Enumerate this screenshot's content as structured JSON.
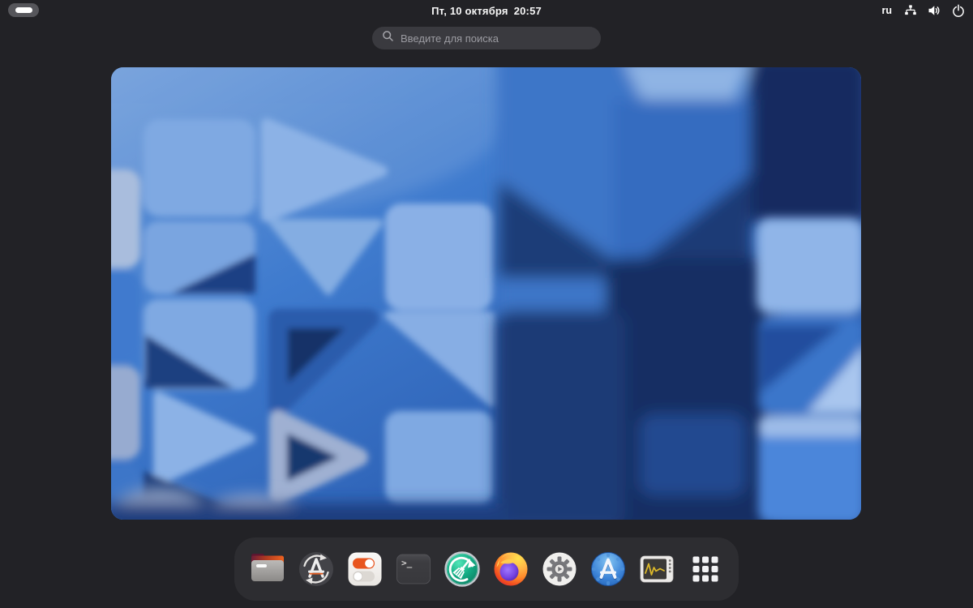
{
  "topbar": {
    "date": "Пт, 10 октября",
    "time": "20:57",
    "keyboard_layout": "ru",
    "status_icons": [
      "network-wired",
      "volume-on",
      "power"
    ],
    "workspace_indicator": "single-active-workspace"
  },
  "search": {
    "placeholder": "Введите для поиска"
  },
  "workspace": {
    "description": "abstract-blue-3d-blocks-wallpaper"
  },
  "dock": {
    "items": [
      "files-icon",
      "software-update-icon",
      "toggles-settings-icon",
      "terminal-icon",
      "system-cleaner-icon",
      "firefox-icon",
      "settings-gear-icon",
      "astra-app-icon",
      "system-monitor-icon",
      "app-grid-icon"
    ]
  },
  "colors": {
    "background": "#222226",
    "dock_background": "#2d2d31",
    "search_background": "#3a3a3f",
    "accent_orange": "#e8551f",
    "wallpaper_blue": "#3a74c8",
    "wallpaper_light_blue": "#85ade4",
    "wallpaper_navy": "#152f64"
  }
}
